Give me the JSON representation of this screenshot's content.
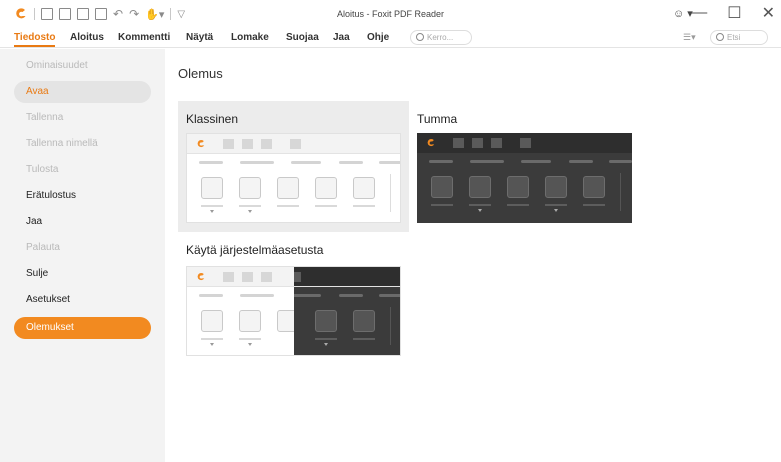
{
  "window": {
    "title": "Aloitus - Foxit PDF Reader"
  },
  "ribbon": {
    "tabs": [
      "Tiedosto",
      "Aloitus",
      "Kommentti",
      "Näytä",
      "Lomake",
      "Suojaa",
      "Jaa",
      "Ohje"
    ],
    "tell_me_placeholder": "Kerro...",
    "search_placeholder": "Etsi"
  },
  "sidebar": {
    "items": [
      {
        "label": "Ominaisuudet",
        "state": "disabled"
      },
      {
        "label": "Avaa",
        "state": "hover"
      },
      {
        "label": "Tallenna",
        "state": "disabled"
      },
      {
        "label": "Tallenna nimellä",
        "state": "disabled"
      },
      {
        "label": "Tulosta",
        "state": "disabled"
      },
      {
        "label": "Erätulostus",
        "state": "enabled"
      },
      {
        "label": "Jaa",
        "state": "enabled"
      },
      {
        "label": "Palauta",
        "state": "disabled"
      },
      {
        "label": "Sulje",
        "state": "enabled"
      },
      {
        "label": "Asetukset",
        "state": "enabled"
      },
      {
        "label": "Olemukset",
        "state": "selected"
      }
    ]
  },
  "main": {
    "title": "Olemus",
    "themes": [
      {
        "label": "Klassinen",
        "selected": true
      },
      {
        "label": "Tumma",
        "selected": false
      },
      {
        "label": "Käytä järjestelmäasetusta",
        "selected": false
      }
    ]
  },
  "colors": {
    "accent": "#f28a20",
    "dark_preview": "#3b3b3b",
    "sidebar_bg": "#f3f3f3"
  }
}
